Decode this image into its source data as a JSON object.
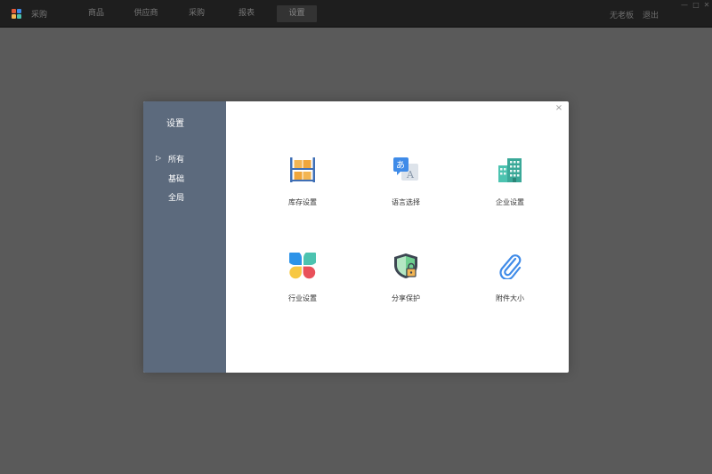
{
  "app": {
    "name": "采购"
  },
  "nav": {
    "tabs": [
      {
        "label": "商品"
      },
      {
        "label": "供应商"
      },
      {
        "label": "采购"
      },
      {
        "label": "报表"
      },
      {
        "label": "设置"
      }
    ],
    "active_tab": "设置"
  },
  "header_right": {
    "user": "无老板",
    "logout": "退出"
  },
  "window_controls": {
    "minimize": "—",
    "maximize": "□",
    "close": "✕"
  },
  "modal": {
    "side_title": "设置",
    "categories": [
      {
        "label": "所有",
        "selected": true
      },
      {
        "label": "基础",
        "selected": false
      },
      {
        "label": "全局",
        "selected": false
      }
    ],
    "selected_marker": "▷",
    "close_glyph": "×",
    "tiles": [
      {
        "label": "库存设置",
        "icon": "warehouse-shelf-icon"
      },
      {
        "label": "语言选择",
        "icon": "translate-icon",
        "icon_text_a": "あ",
        "icon_text_b": "A"
      },
      {
        "label": "企业设置",
        "icon": "office-building-icon"
      },
      {
        "label": "行业设置",
        "icon": "industry-petals-icon"
      },
      {
        "label": "分享保护",
        "icon": "shield-lock-icon"
      },
      {
        "label": "附件大小",
        "icon": "paperclip-icon"
      }
    ]
  },
  "colors": {
    "backdrop": "#5a5a5a",
    "topbar": "#1e1e1e",
    "sidebar": "#5c6a7d",
    "accent_blue": "#3f8be8",
    "accent_orange": "#f3b553",
    "accent_teal": "#4cc3b0"
  }
}
